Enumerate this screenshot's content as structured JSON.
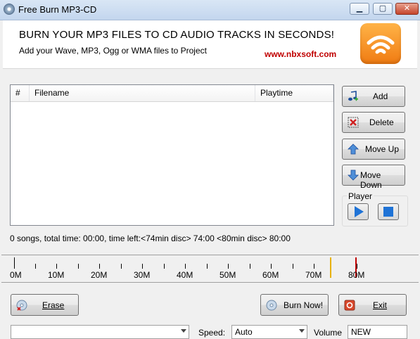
{
  "window": {
    "title": "Free Burn MP3-CD"
  },
  "banner": {
    "headline": "BURN YOUR MP3 FILES TO CD AUDIO TRACKS IN SECONDS!",
    "subtitle": "Add your Wave, MP3, Ogg or WMA files to Project",
    "url": "www.nbxsoft.com"
  },
  "list": {
    "columns": [
      "#",
      "Filename",
      "Playtime"
    ]
  },
  "buttons": {
    "add": "Add",
    "delete": "Delete",
    "move_up": "Move Up",
    "move_down": "Move Down",
    "erase": "Erase",
    "burn_now": "Burn Now!",
    "exit": "Exit"
  },
  "player": {
    "label": "Player"
  },
  "status": "0 songs, total time: 00:00, time left:<74min disc> 74:00 <80min disc> 80:00",
  "ruler": {
    "labels": [
      "0M",
      "10M",
      "20M",
      "30M",
      "40M",
      "50M",
      "60M",
      "70M",
      "80M"
    ],
    "marker_74_color": "#e8b100",
    "marker_80_color": "#c00000"
  },
  "bottom": {
    "speed_label": "Speed:",
    "speed_value": "Auto",
    "volume_label": "Volume",
    "volume_value": "NEW"
  },
  "colors": {
    "accent_orange": "#f07b12",
    "url_red": "#c00000",
    "play_blue": "#1f73d6"
  }
}
